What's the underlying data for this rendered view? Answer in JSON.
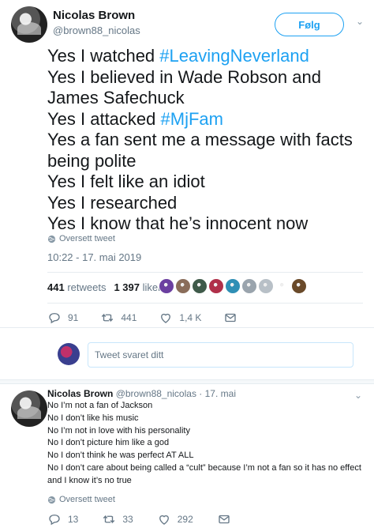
{
  "main_tweet": {
    "author_name": "Nicolas Brown",
    "author_handle": "@brown88_nicolas",
    "follow_label": "Følg",
    "lines": [
      {
        "prefix": "Yes I watched ",
        "hashtag": "#LeavingNeverland"
      },
      {
        "prefix": "Yes I believed in Wade Robson and",
        "hashtag": ""
      },
      {
        "prefix": "James Safechuck",
        "hashtag": ""
      },
      {
        "prefix": "Yes I attacked ",
        "hashtag": "#MjFam"
      },
      {
        "prefix": "Yes a fan sent me a message with facts",
        "hashtag": ""
      },
      {
        "prefix": "being polite",
        "hashtag": ""
      },
      {
        "prefix": "Yes I felt like an idiot",
        "hashtag": ""
      },
      {
        "prefix": "Yes I researched",
        "hashtag": ""
      },
      {
        "prefix": "Yes I know that he’s innocent now",
        "hashtag": ""
      }
    ],
    "translate_label": "Oversett tweet",
    "timestamp": "10:22 - 17. mai 2019",
    "retweets_count": "441",
    "retweets_label": "retweets",
    "likes_count": "1 397",
    "likes_label": "liker",
    "actions": {
      "replies": "91",
      "retweets": "441",
      "likes": "1,4 K"
    }
  },
  "likers": [
    {
      "color": "#6b3fa0"
    },
    {
      "color": "#8a6d5a"
    },
    {
      "color": "#3f5a4a"
    },
    {
      "color": "#b0304a"
    },
    {
      "color": "#2f8fb5"
    },
    {
      "color": "#9aa4ad"
    },
    {
      "color": "#b8c0c7"
    },
    {
      "color": "#ffffff"
    },
    {
      "color": "#6a4a2a"
    }
  ],
  "reply_box": {
    "placeholder": "Tweet svaret ditt"
  },
  "reply_tweet": {
    "author_name": "Nicolas Brown",
    "author_handle": "@brown88_nicolas",
    "date": "· 17. mai",
    "lines": [
      "No I’m not a fan of Jackson",
      "No I don’t like his music",
      "No I’m not in love with his personality",
      "No I don’t picture him like a god",
      "No I don’t think he was perfect AT ALL",
      "No I don’t care about being called a “cult” because I’m not a fan so it has no effect",
      "and I know it’s no true"
    ],
    "translate_label": "Oversett tweet",
    "actions": {
      "replies": "13",
      "retweets": "33",
      "likes": "292"
    }
  },
  "colors": {
    "accent": "#1da1f2",
    "secondary_text": "#657786",
    "like_red": "#e0245e"
  }
}
